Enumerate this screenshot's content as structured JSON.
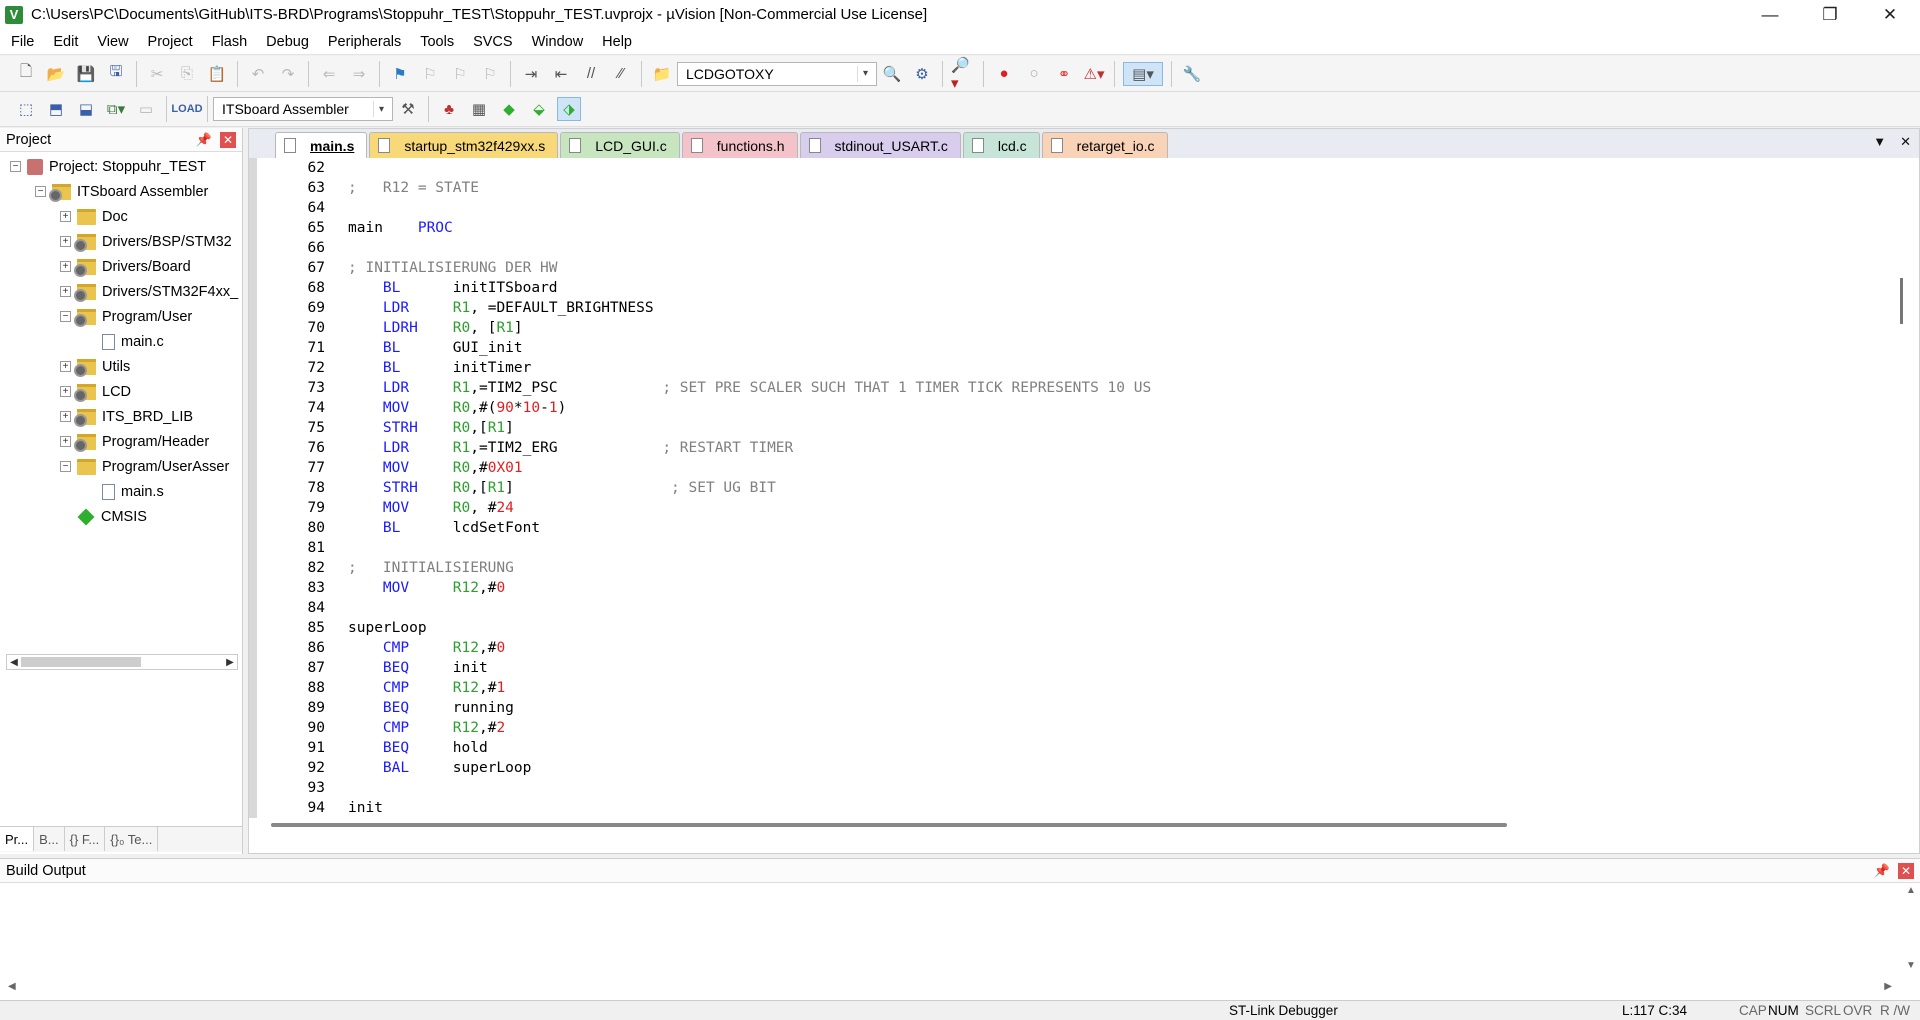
{
  "window": {
    "title": "C:\\Users\\PC\\Documents\\GitHub\\ITS-BRD\\Programs\\Stoppuhr_TEST\\Stoppuhr_TEST.uvprojx - µVision  [Non-Commercial Use License]",
    "app_icon_letter": "V"
  },
  "menu": [
    "File",
    "Edit",
    "View",
    "Project",
    "Flash",
    "Debug",
    "Peripherals",
    "Tools",
    "SVCS",
    "Window",
    "Help"
  ],
  "toolbar": {
    "find_combo_value": "LCDGOTOXY",
    "target_combo_value": "ITSboard Assembler"
  },
  "project_panel": {
    "title": "Project",
    "tree": [
      {
        "label": "Project: Stoppuhr_TEST",
        "level": 0,
        "expander": "−",
        "icon": "project"
      },
      {
        "label": "ITSboard Assembler",
        "level": 1,
        "expander": "−",
        "icon": "folder-gear"
      },
      {
        "label": "Doc",
        "level": 2,
        "expander": "+",
        "icon": "folder"
      },
      {
        "label": "Drivers/BSP/STM32",
        "level": 2,
        "expander": "+",
        "icon": "folder-gear"
      },
      {
        "label": "Drivers/Board",
        "level": 2,
        "expander": "+",
        "icon": "folder-gear"
      },
      {
        "label": "Drivers/STM32F4xx_",
        "level": 2,
        "expander": "+",
        "icon": "folder-gear"
      },
      {
        "label": "Program/User",
        "level": 2,
        "expander": "−",
        "icon": "folder-gear"
      },
      {
        "label": "main.c",
        "level": 3,
        "expander": "",
        "icon": "file"
      },
      {
        "label": "Utils",
        "level": 2,
        "expander": "+",
        "icon": "folder-gear"
      },
      {
        "label": "LCD",
        "level": 2,
        "expander": "+",
        "icon": "folder-gear"
      },
      {
        "label": "ITS_BRD_LIB",
        "level": 2,
        "expander": "+",
        "icon": "folder-gear"
      },
      {
        "label": "Program/Header",
        "level": 2,
        "expander": "+",
        "icon": "folder-gear"
      },
      {
        "label": "Program/UserAsser",
        "level": 2,
        "expander": "−",
        "icon": "folder"
      },
      {
        "label": "main.s",
        "level": 3,
        "expander": "",
        "icon": "file"
      },
      {
        "label": "CMSIS",
        "level": 2,
        "expander": "",
        "icon": "diamond"
      }
    ],
    "bottom_tabs": [
      "Pr...",
      "B...",
      "{} F...",
      "{}₀ Te..."
    ]
  },
  "editor": {
    "tabs": [
      {
        "label": "main.s",
        "active": true,
        "bg": "#ffffff"
      },
      {
        "label": "startup_stm32f429xx.s",
        "active": false,
        "bg": "#f7d97a"
      },
      {
        "label": "LCD_GUI.c",
        "active": false,
        "bg": "#c7e6c0"
      },
      {
        "label": "functions.h",
        "active": false,
        "bg": "#f4c3c9"
      },
      {
        "label": "stdinout_USART.c",
        "active": false,
        "bg": "#d9cdee"
      },
      {
        "label": "lcd.c",
        "active": false,
        "bg": "#c6e4d7"
      },
      {
        "label": "retarget_io.c",
        "active": false,
        "bg": "#f8d3b7"
      }
    ],
    "lines": [
      {
        "n": "62",
        "code": []
      },
      {
        "n": "63",
        "code": [
          {
            "t": ";   R12 = STATE",
            "c": "cmt"
          }
        ]
      },
      {
        "n": "64",
        "code": []
      },
      {
        "n": "65",
        "code": [
          {
            "t": "main    ",
            "c": "plain"
          },
          {
            "t": "PROC",
            "c": "kw"
          }
        ]
      },
      {
        "n": "66",
        "code": []
      },
      {
        "n": "67",
        "code": [
          {
            "t": "; INITIALISIERUNG DER HW",
            "c": "cmt"
          }
        ]
      },
      {
        "n": "68",
        "code": [
          {
            "t": "    ",
            "c": "plain"
          },
          {
            "t": "BL",
            "c": "ins"
          },
          {
            "t": "      initITSboard",
            "c": "plain"
          }
        ]
      },
      {
        "n": "69",
        "code": [
          {
            "t": "    ",
            "c": "plain"
          },
          {
            "t": "LDR",
            "c": "ins"
          },
          {
            "t": "     ",
            "c": "plain"
          },
          {
            "t": "R1",
            "c": "reg"
          },
          {
            "t": ", =DEFAULT_BRIGHTNESS",
            "c": "plain"
          }
        ]
      },
      {
        "n": "70",
        "code": [
          {
            "t": "    ",
            "c": "plain"
          },
          {
            "t": "LDRH",
            "c": "ins"
          },
          {
            "t": "    ",
            "c": "plain"
          },
          {
            "t": "R0",
            "c": "reg"
          },
          {
            "t": ", [",
            "c": "plain"
          },
          {
            "t": "R1",
            "c": "reg"
          },
          {
            "t": "]",
            "c": "plain"
          }
        ]
      },
      {
        "n": "71",
        "code": [
          {
            "t": "    ",
            "c": "plain"
          },
          {
            "t": "BL",
            "c": "ins"
          },
          {
            "t": "      GUI_init",
            "c": "plain"
          }
        ]
      },
      {
        "n": "72",
        "code": [
          {
            "t": "    ",
            "c": "plain"
          },
          {
            "t": "BL",
            "c": "ins"
          },
          {
            "t": "      initTimer",
            "c": "plain"
          }
        ]
      },
      {
        "n": "73",
        "code": [
          {
            "t": "    ",
            "c": "plain"
          },
          {
            "t": "LDR",
            "c": "ins"
          },
          {
            "t": "     ",
            "c": "plain"
          },
          {
            "t": "R1",
            "c": "reg"
          },
          {
            "t": ",=TIM2_PSC            ",
            "c": "plain"
          },
          {
            "t": "; SET PRE SCALER SUCH THAT 1 TIMER TICK REPRESENTS 10 US",
            "c": "cmt"
          }
        ]
      },
      {
        "n": "74",
        "code": [
          {
            "t": "    ",
            "c": "plain"
          },
          {
            "t": "MOV",
            "c": "ins"
          },
          {
            "t": "     ",
            "c": "plain"
          },
          {
            "t": "R0",
            "c": "reg"
          },
          {
            "t": ",#(",
            "c": "plain"
          },
          {
            "t": "90",
            "c": "num"
          },
          {
            "t": "*",
            "c": "plain"
          },
          {
            "t": "10",
            "c": "num"
          },
          {
            "t": "-",
            "c": "plain"
          },
          {
            "t": "1",
            "c": "num"
          },
          {
            "t": ")",
            "c": "plain"
          }
        ]
      },
      {
        "n": "75",
        "code": [
          {
            "t": "    ",
            "c": "plain"
          },
          {
            "t": "STRH",
            "c": "ins"
          },
          {
            "t": "    ",
            "c": "plain"
          },
          {
            "t": "R0",
            "c": "reg"
          },
          {
            "t": ",[",
            "c": "plain"
          },
          {
            "t": "R1",
            "c": "reg"
          },
          {
            "t": "]",
            "c": "plain"
          }
        ]
      },
      {
        "n": "76",
        "code": [
          {
            "t": "    ",
            "c": "plain"
          },
          {
            "t": "LDR",
            "c": "ins"
          },
          {
            "t": "     ",
            "c": "plain"
          },
          {
            "t": "R1",
            "c": "reg"
          },
          {
            "t": ",=TIM2_ERG            ",
            "c": "plain"
          },
          {
            "t": "; RESTART TIMER",
            "c": "cmt"
          }
        ]
      },
      {
        "n": "77",
        "code": [
          {
            "t": "    ",
            "c": "plain"
          },
          {
            "t": "MOV",
            "c": "ins"
          },
          {
            "t": "     ",
            "c": "plain"
          },
          {
            "t": "R0",
            "c": "reg"
          },
          {
            "t": ",#",
            "c": "plain"
          },
          {
            "t": "0X01",
            "c": "num"
          }
        ]
      },
      {
        "n": "78",
        "code": [
          {
            "t": "    ",
            "c": "plain"
          },
          {
            "t": "STRH",
            "c": "ins"
          },
          {
            "t": "    ",
            "c": "plain"
          },
          {
            "t": "R0",
            "c": "reg"
          },
          {
            "t": ",[",
            "c": "plain"
          },
          {
            "t": "R1",
            "c": "reg"
          },
          {
            "t": "]                  ",
            "c": "plain"
          },
          {
            "t": "; SET UG BIT",
            "c": "cmt"
          }
        ]
      },
      {
        "n": "79",
        "code": [
          {
            "t": "    ",
            "c": "plain"
          },
          {
            "t": "MOV",
            "c": "ins"
          },
          {
            "t": "     ",
            "c": "plain"
          },
          {
            "t": "R0",
            "c": "reg"
          },
          {
            "t": ", #",
            "c": "plain"
          },
          {
            "t": "24",
            "c": "num"
          }
        ]
      },
      {
        "n": "80",
        "code": [
          {
            "t": "    ",
            "c": "plain"
          },
          {
            "t": "BL",
            "c": "ins"
          },
          {
            "t": "      lcdSetFont",
            "c": "plain"
          }
        ]
      },
      {
        "n": "81",
        "code": []
      },
      {
        "n": "82",
        "code": [
          {
            "t": ";   INITIALISIERUNG",
            "c": "cmt"
          }
        ]
      },
      {
        "n": "83",
        "code": [
          {
            "t": "    ",
            "c": "plain"
          },
          {
            "t": "MOV",
            "c": "ins"
          },
          {
            "t": "     ",
            "c": "plain"
          },
          {
            "t": "R12",
            "c": "reg"
          },
          {
            "t": ",#",
            "c": "plain"
          },
          {
            "t": "0",
            "c": "num"
          }
        ]
      },
      {
        "n": "84",
        "code": []
      },
      {
        "n": "85",
        "code": [
          {
            "t": "superLoop",
            "c": "plain"
          }
        ]
      },
      {
        "n": "86",
        "code": [
          {
            "t": "    ",
            "c": "plain"
          },
          {
            "t": "CMP",
            "c": "ins"
          },
          {
            "t": "     ",
            "c": "plain"
          },
          {
            "t": "R12",
            "c": "reg"
          },
          {
            "t": ",#",
            "c": "plain"
          },
          {
            "t": "0",
            "c": "num"
          }
        ]
      },
      {
        "n": "87",
        "code": [
          {
            "t": "    ",
            "c": "plain"
          },
          {
            "t": "BEQ",
            "c": "ins"
          },
          {
            "t": "     init",
            "c": "plain"
          }
        ]
      },
      {
        "n": "88",
        "code": [
          {
            "t": "    ",
            "c": "plain"
          },
          {
            "t": "CMP",
            "c": "ins"
          },
          {
            "t": "     ",
            "c": "plain"
          },
          {
            "t": "R12",
            "c": "reg"
          },
          {
            "t": ",#",
            "c": "plain"
          },
          {
            "t": "1",
            "c": "num"
          }
        ]
      },
      {
        "n": "89",
        "code": [
          {
            "t": "    ",
            "c": "plain"
          },
          {
            "t": "BEQ",
            "c": "ins"
          },
          {
            "t": "     running",
            "c": "plain"
          }
        ]
      },
      {
        "n": "90",
        "code": [
          {
            "t": "    ",
            "c": "plain"
          },
          {
            "t": "CMP",
            "c": "ins"
          },
          {
            "t": "     ",
            "c": "plain"
          },
          {
            "t": "R12",
            "c": "reg"
          },
          {
            "t": ",#",
            "c": "plain"
          },
          {
            "t": "2",
            "c": "num"
          }
        ]
      },
      {
        "n": "91",
        "code": [
          {
            "t": "    ",
            "c": "plain"
          },
          {
            "t": "BEQ",
            "c": "ins"
          },
          {
            "t": "     hold",
            "c": "plain"
          }
        ]
      },
      {
        "n": "92",
        "code": [
          {
            "t": "    ",
            "c": "plain"
          },
          {
            "t": "BAL",
            "c": "ins"
          },
          {
            "t": "     superLoop",
            "c": "plain"
          }
        ]
      },
      {
        "n": "93",
        "code": []
      },
      {
        "n": "94",
        "code": [
          {
            "t": "init",
            "c": "plain"
          }
        ]
      }
    ]
  },
  "build_output": {
    "title": "Build Output"
  },
  "statusbar": {
    "debugger": "ST-Link Debugger",
    "position": "L:117 C:34",
    "indicators": [
      {
        "label": "CAP",
        "on": false
      },
      {
        "label": "NUM",
        "on": true
      },
      {
        "label": "SCRL",
        "on": false
      },
      {
        "label": "OVR",
        "on": false
      },
      {
        "label": "R /W",
        "on": false
      }
    ]
  }
}
